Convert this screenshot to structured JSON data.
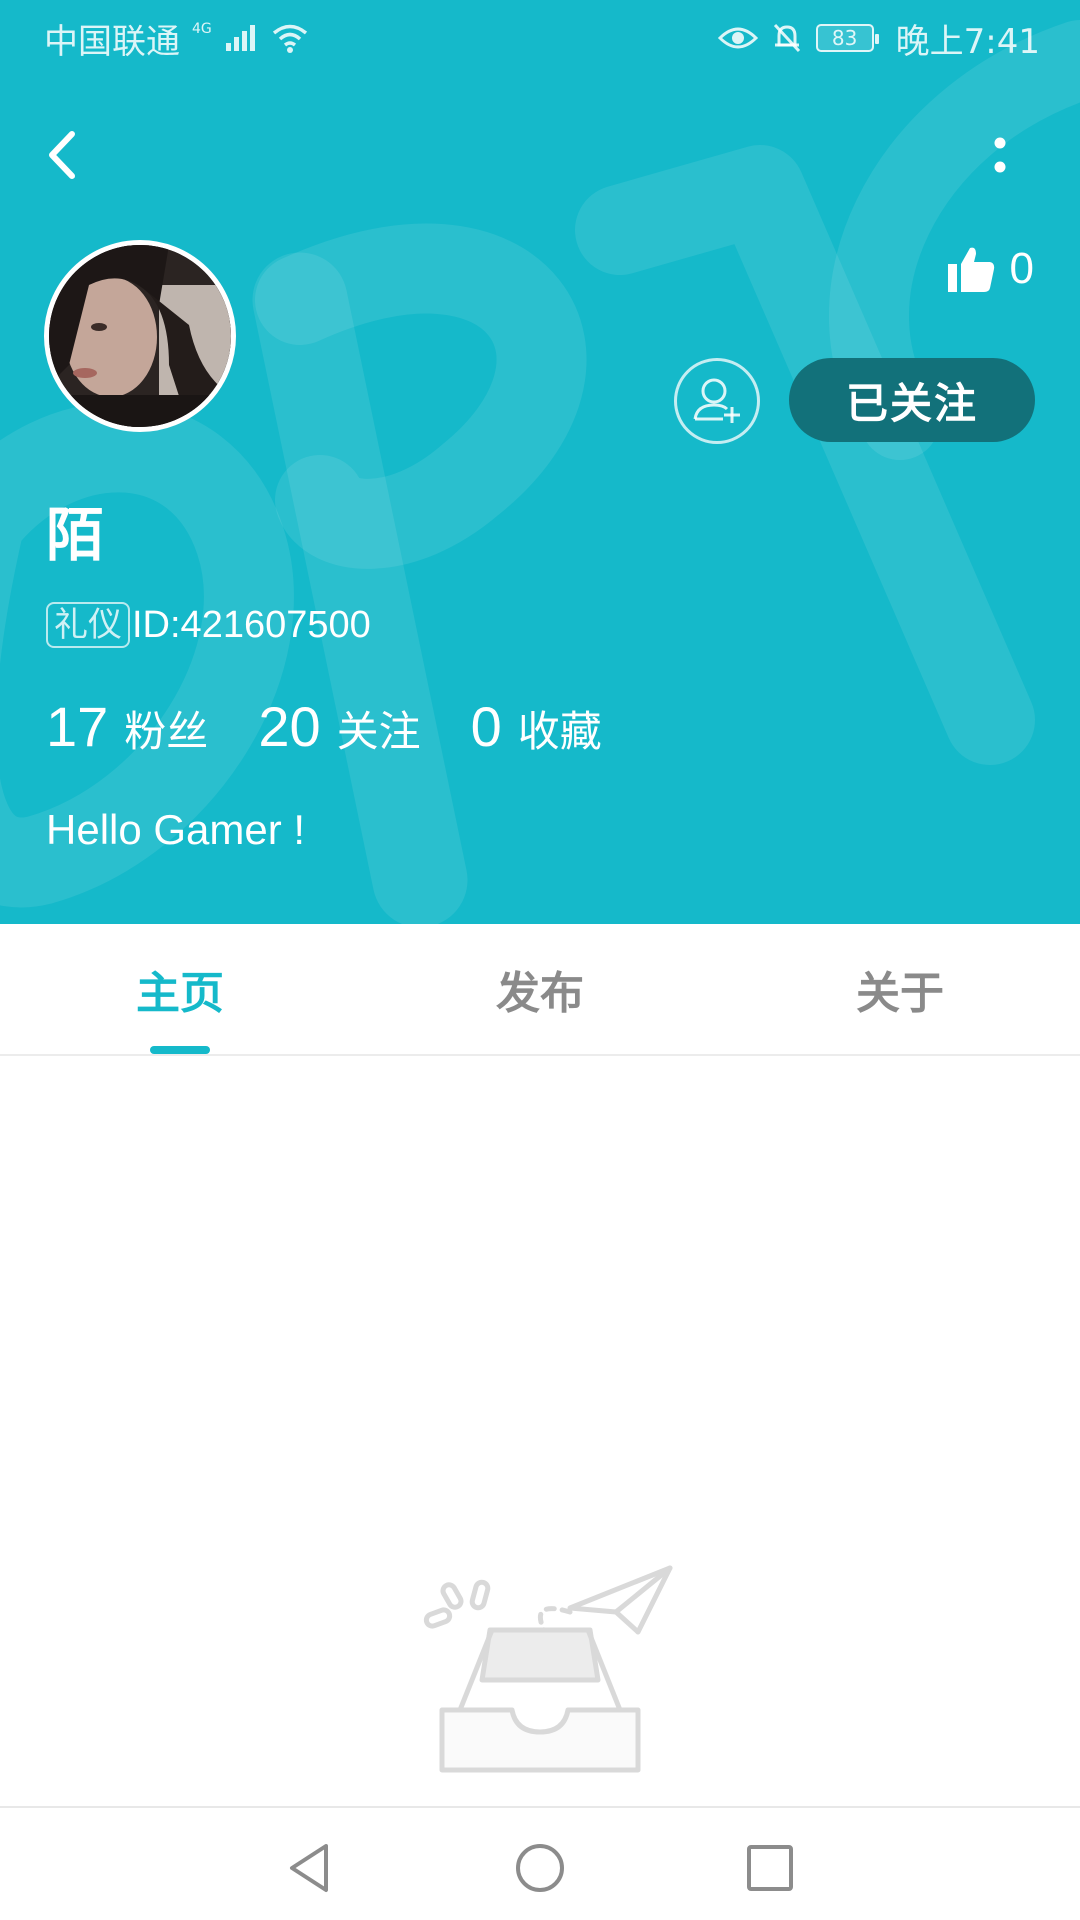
{
  "status_bar": {
    "carrier": "中国联通",
    "network": "4G",
    "battery": "83",
    "time": "晚上7:41"
  },
  "profile": {
    "name": "陌",
    "badge": "礼仪",
    "id_text": "ID:421607500",
    "likes": "0",
    "follow_button": "已关注",
    "bio": "Hello Gamer !",
    "stats": [
      {
        "value": "17",
        "label": "粉丝"
      },
      {
        "value": "20",
        "label": "关注"
      },
      {
        "value": "0",
        "label": "收藏"
      }
    ]
  },
  "tabs": [
    {
      "label": "主页",
      "active": true
    },
    {
      "label": "发布",
      "active": false
    },
    {
      "label": "关于",
      "active": false
    }
  ],
  "icons": {
    "back": "chevron-left-icon",
    "more": "more-vertical-icon",
    "like": "thumbs-up-icon",
    "add_friend": "add-user-icon",
    "empty": "empty-inbox-illustration",
    "nav_back": "triangle-back-icon",
    "nav_home": "circle-home-icon",
    "nav_recent": "square-recent-icon"
  },
  "colors": {
    "primary": "#15b9ca",
    "follow_bg": "#12717a",
    "tab_inactive": "#8a8a8a"
  }
}
